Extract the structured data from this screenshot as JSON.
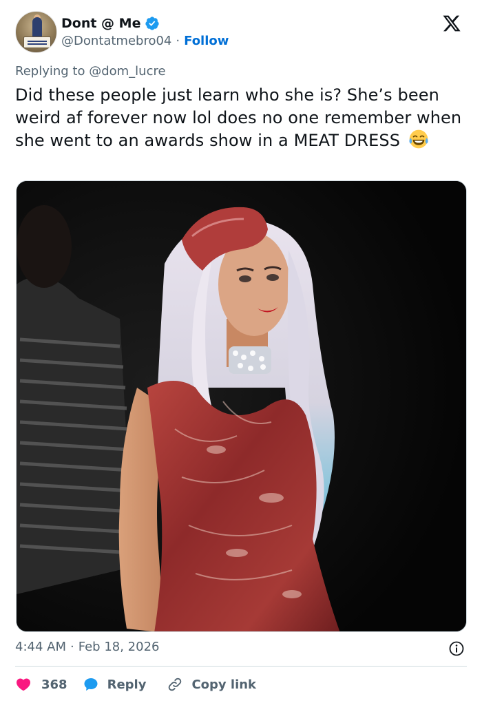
{
  "author": {
    "display_name": "Dont @ Me",
    "handle": "@Dontatmebro04",
    "separator": "·",
    "follow_label": "Follow",
    "verified": true
  },
  "reply_context": {
    "prefix": "Replying to ",
    "mention": "@dom_lucre"
  },
  "tweet": {
    "text": "Did these people just learn who she is? She’s been weird af forever now lol does no one remember when she went to an awards show in a MEAT DRESS",
    "emoji": "face-with-tears-of-joy",
    "time": "4:44 AM",
    "separator": "·",
    "date": "Feb 18, 2026"
  },
  "media": {
    "type": "photo"
  },
  "actions": {
    "like_count": "368",
    "reply_label": "Reply",
    "copy_link_label": "Copy link"
  },
  "colors": {
    "text_primary": "#0f1419",
    "text_secondary": "#536471",
    "link_blue": "#006fd6",
    "verified_blue": "#1d9bf0",
    "like_red": "#f91880",
    "border": "#cfd9de"
  }
}
